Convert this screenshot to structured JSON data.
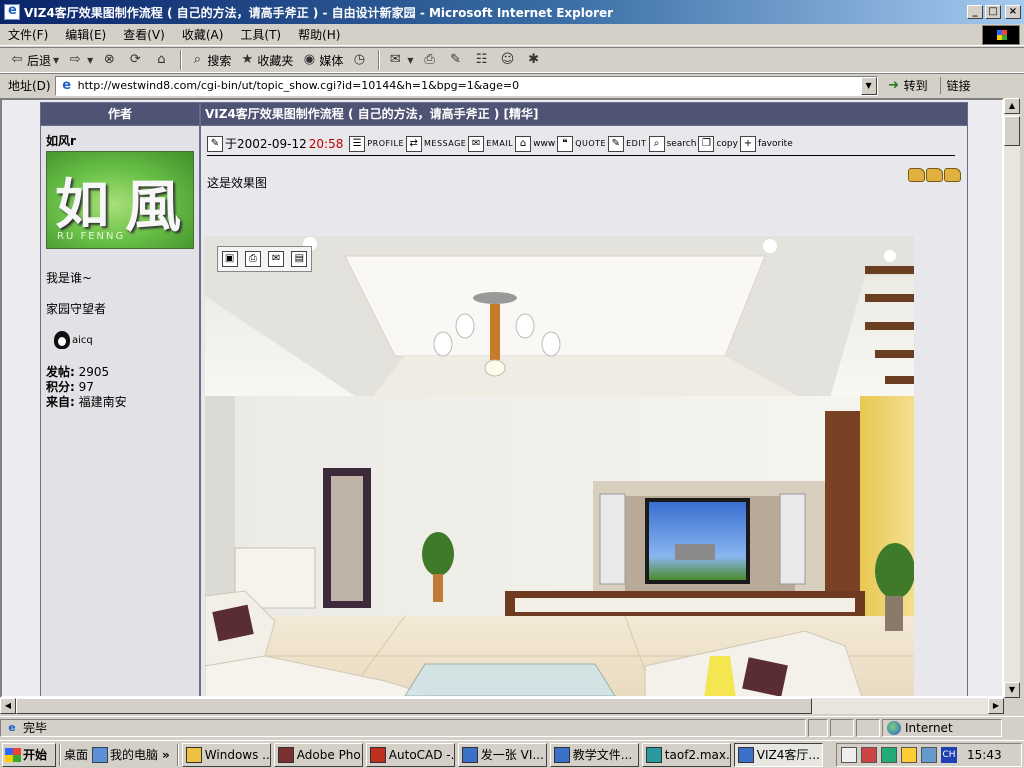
{
  "window": {
    "title": "VIZ4客厅效果图制作流程 ( 自己的方法，请高手斧正 ) - 自由设计新家园 - Microsoft Internet Explorer",
    "buttons": {
      "minimize": "_",
      "maximize": "□",
      "close": "×"
    }
  },
  "menu": [
    "文件(F)",
    "编辑(E)",
    "查看(V)",
    "收藏(A)",
    "工具(T)",
    "帮助(H)"
  ],
  "toolbar": {
    "back": "后退",
    "search": "搜索",
    "favorites": "收藏夹",
    "media": "媒体"
  },
  "address": {
    "label": "地址(D)",
    "url": "http://westwind8.com/cgi-bin/ut/topic_show.cgi?id=10144&h=1&bpg=1&age=0",
    "go": "转到",
    "links": "链接"
  },
  "forum": {
    "header_author": "作者",
    "header_title": "VIZ4客厅效果图制作流程 ( 自己的方法，请高手斧正 ) [精华]",
    "author": {
      "name": "如风r",
      "avatar_text": "RU FENNG",
      "avatar_glyph_1": "如",
      "avatar_glyph_2": "風",
      "who": "我是谁~",
      "role": "家园守望者",
      "qq": "aicq",
      "posts_label": "发帖:",
      "posts": "2905",
      "points_label": "积分:",
      "points": "97",
      "from_label": "来自:",
      "from": "福建南安"
    },
    "post": {
      "date": "于2002-09-12",
      "time": "20:58",
      "actions": [
        "PROFILE",
        "MESSAGE",
        "EMAIL",
        "www",
        "QUOTE",
        "EDIT",
        "search",
        "copy",
        "favorite"
      ],
      "text": "这是效果图"
    }
  },
  "status": {
    "text": "完毕",
    "zone": "Internet"
  },
  "taskbar": {
    "start": "开始",
    "desktop": "桌面",
    "my_computer": "我的电脑",
    "more": "»",
    "tasks": [
      "Windows ...",
      "Adobe Pho...",
      "AutoCAD -...",
      "发一张 VI...",
      "教学文件...",
      "taof2.max...",
      "VIZ4客厅..."
    ],
    "ime": "CH",
    "clock": "15:43"
  },
  "colors": {
    "title_gradient_start": "#0a246a",
    "forum_header": "#505474",
    "post_time": "#c00000"
  }
}
